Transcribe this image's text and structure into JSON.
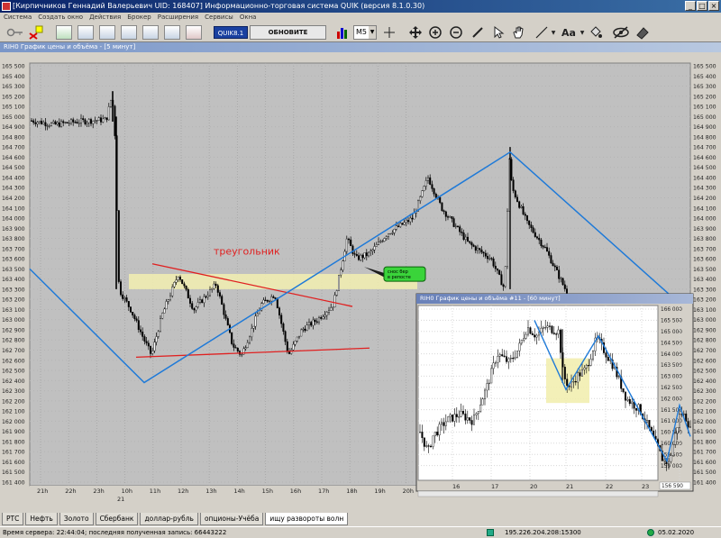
{
  "window": {
    "title": "[Кирпичников Геннадий Валерьевич UID: 168407] Информационно-торговая система QUIK (версия 8.1.0.30)"
  },
  "menu": [
    "Система",
    "Создать окно",
    "Действия",
    "Брокер",
    "Расширения",
    "Сервисы",
    "Окна"
  ],
  "toolbar": {
    "quik_label": "QUIK8.1",
    "refresh_label": "ОБНОВИТЕ СЕГОДНЯ",
    "timeframe": "M5",
    "text_tool": "Aa"
  },
  "main_chart": {
    "title": "RIH0 График цены и объёма - [5 минут]",
    "annotation": "треугольник",
    "note_line1": "снос бер",
    "note_line2": "в репосте",
    "colors": {
      "zigzag": "#1f7ad8",
      "triangle": "#e02020",
      "zone": "#f2eeb0",
      "candle": "#000000"
    }
  },
  "sub_chart": {
    "title": "RIH0 График цены и объёма #11 - [60 минут]",
    "current_price": "156 590"
  },
  "tabs": [
    "РТС",
    "Нефть",
    "Золото",
    "Сбербанк",
    "доллар-рубль",
    "опционы-Учёба",
    "ищу развороты волн"
  ],
  "active_tab": 6,
  "status": {
    "server_time": "Время сервера: 22:44:04; последняя полученная запись: 66443222",
    "connection": "195.226.204.208:15300",
    "date": "05.02.2020"
  },
  "chart_data": [
    {
      "type": "line",
      "title": "RIH0 График цены и объёма - [5 минут]",
      "y_tick_labels": [
        "165 500",
        "165 400",
        "165 300",
        "165 200",
        "165 100",
        "165 000",
        "164 900",
        "164 800",
        "164 700",
        "164 600",
        "164 500",
        "164 400",
        "164 300",
        "164 200",
        "164 100",
        "164 000",
        "163 900",
        "163 800",
        "163 700",
        "163 600",
        "163 500",
        "163 400",
        "163 300",
        "163 200",
        "163 100",
        "163 000",
        "162 900",
        "162 800",
        "162 700",
        "162 600",
        "162 500",
        "162 400",
        "162 300",
        "162 200",
        "162 100",
        "162 000",
        "161 900",
        "161 800",
        "161 700",
        "161 600",
        "161 500",
        "161 400"
      ],
      "x_tick_labels": [
        "21h",
        "22h",
        "23h",
        "10h",
        "11h",
        "12h",
        "13h",
        "14h",
        "15h",
        "16h",
        "17h",
        "18h",
        "19h",
        "20h"
      ],
      "x_date_label": "21",
      "ylim": [
        161400,
        165500
      ],
      "series": [
        {
          "values": [
            164960,
            164900,
            164960,
            165200,
            163600,
            162600,
            163450,
            162700,
            163100,
            162650,
            162600,
            163250,
            163800,
            164200,
            164400,
            164000,
            163400,
            164700,
            163900,
            163100
          ]
        }
      ]
    },
    {
      "type": "line",
      "title": "RIH0 График цены и объёма #11 - [60 минут]",
      "y_tick_labels": [
        "166 000",
        "165 500",
        "165 000",
        "164 500",
        "164 000",
        "163 500",
        "163 000",
        "162 500",
        "162 000",
        "161 500",
        "161 000",
        "160 500",
        "160 000",
        "159 500",
        "159 000"
      ],
      "x_tick_labels": [
        "16",
        "17",
        "20",
        "21",
        "22",
        "23",
        "24"
      ],
      "ylim": [
        158500,
        166000
      ],
      "series": [
        {
          "values": [
            160500,
            160200,
            160800,
            161000,
            161200,
            163000,
            164000,
            164800,
            165200,
            164500,
            165200,
            163000,
            162400,
            163800,
            164600,
            162600,
            160800,
            159100,
            161600,
            160700
          ]
        }
      ]
    }
  ]
}
